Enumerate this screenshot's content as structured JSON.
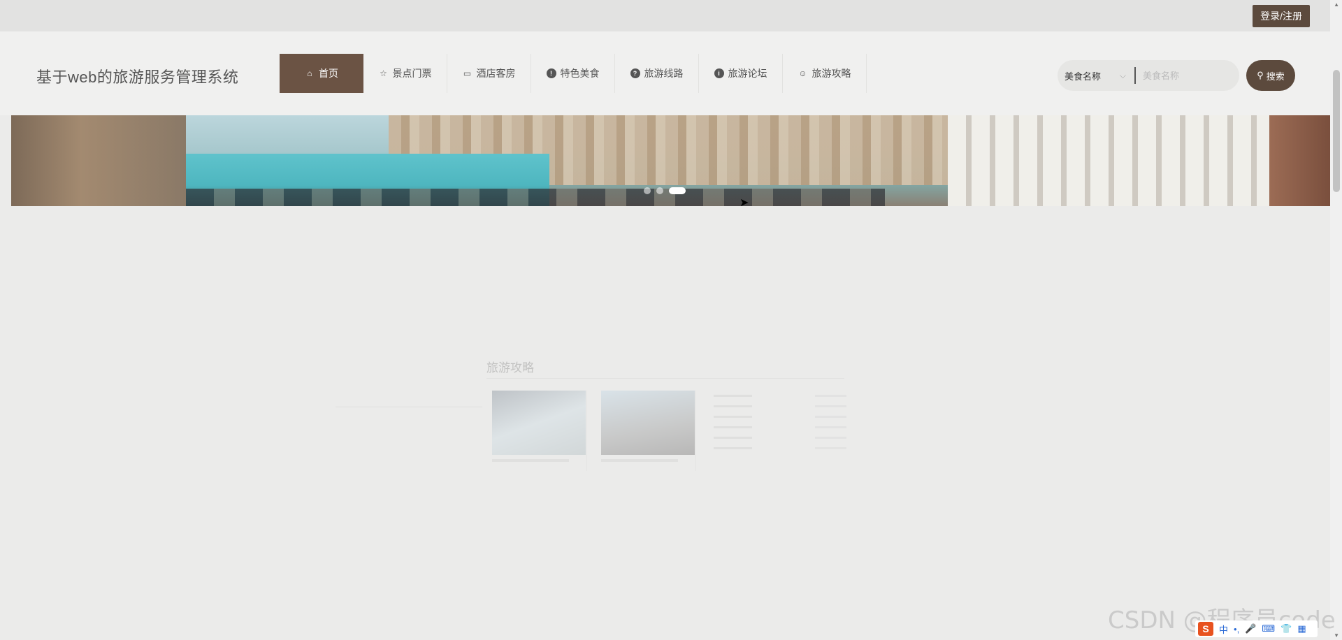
{
  "top_bar": {
    "login_label": "登录/注册"
  },
  "header": {
    "site_title": "基于web的旅游服务管理系统",
    "nav": [
      {
        "label": "首页",
        "icon": "home-icon",
        "active": true
      },
      {
        "label": "景点门票",
        "icon": "star-icon"
      },
      {
        "label": "酒店客房",
        "icon": "bag-icon"
      },
      {
        "label": "特色美食",
        "icon": "info-icon"
      },
      {
        "label": "旅游线路",
        "icon": "question-icon"
      },
      {
        "label": "旅游论坛",
        "icon": "info-icon"
      },
      {
        "label": "旅游攻略",
        "icon": "smile-icon"
      }
    ],
    "search": {
      "select_value": "美食名称",
      "placeholder": "美食名称",
      "button_label": "搜索"
    }
  },
  "banner": {
    "slide_count": 3,
    "active_slide": 3
  },
  "guide_section": {
    "title": "旅游攻略"
  },
  "watermark": "CSDN @程序员code",
  "tray": {
    "ime_label": "中"
  },
  "colors": {
    "accent": "#6b5344",
    "button": "#5c4a3d",
    "page_bg": "#ebebea"
  }
}
